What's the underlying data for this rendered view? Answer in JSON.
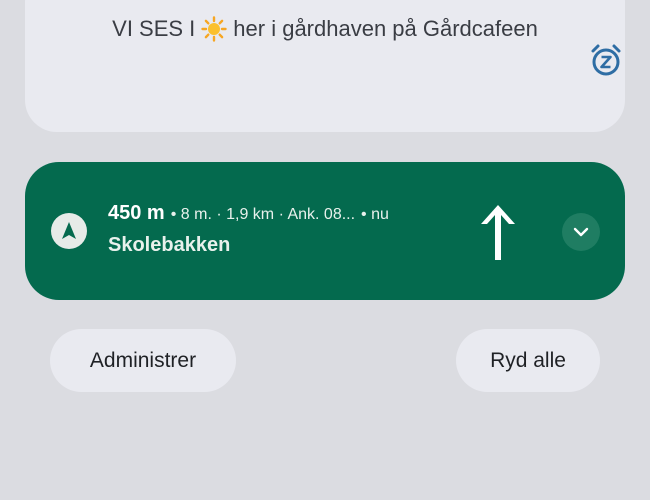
{
  "previous_notification": {
    "text_before": "VI SES I",
    "text_after": "her i gårdhaven på Gårdcafeen",
    "emoji": "sun",
    "snooze_icon": "snooze-alarm-icon"
  },
  "navigation": {
    "distance": "450 m",
    "meta": "• 8 m. · 1,9 km · Ank. 08...",
    "time": "• nu",
    "street": "Skolebakken",
    "direction_icon": "navigation-arrow-icon",
    "turn_icon": "straight-arrow-icon",
    "expand_icon": "chevron-down-icon",
    "colors": {
      "background": "#046a4e",
      "expand_button": "#1f7d62"
    }
  },
  "actions": {
    "manage_label": "Administrer",
    "clear_all_label": "Ryd alle"
  },
  "colors": {
    "page_background": "#dbdce1",
    "card_background": "#e9eaf0",
    "accent_blue": "#2e6da4"
  }
}
